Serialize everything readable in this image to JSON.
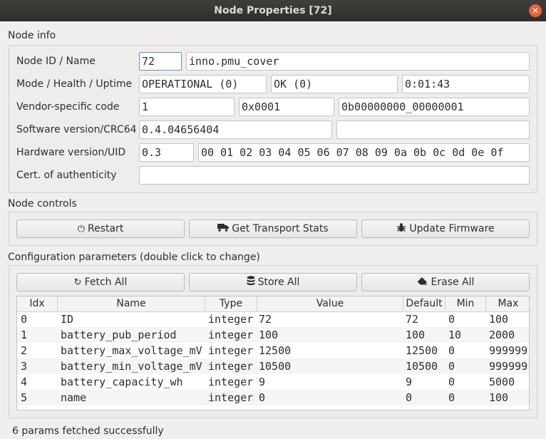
{
  "window": {
    "title": "Node Properties [72]"
  },
  "node_info": {
    "section_label": "Node info",
    "rows": {
      "id_name": {
        "label": "Node ID / Name",
        "id": "72",
        "name": "inno.pmu_cover"
      },
      "mode": {
        "label": "Mode / Health / Uptime",
        "mode": "OPERATIONAL (0)",
        "health": "OK (0)",
        "uptime": "0:01:43"
      },
      "vendor": {
        "label": "Vendor-specific code",
        "code": "1",
        "hex": "0x0001",
        "bin": "0b00000000_00000001"
      },
      "software": {
        "label": "Software version/CRC64",
        "version": "0.4.04656404",
        "crc": ""
      },
      "hardware": {
        "label": "Hardware version/UID",
        "version": "0.3",
        "uid": "00 01 02 03 04 05 06 07 08 09 0a 0b 0c 0d 0e 0f"
      },
      "cert": {
        "label": "Cert. of authenticity",
        "value": ""
      }
    }
  },
  "node_controls": {
    "section_label": "Node controls",
    "restart": "Restart",
    "transport": "Get Transport Stats",
    "firmware": "Update Firmware"
  },
  "config": {
    "section_label": "Configuration parameters (double click to change)",
    "fetch": "Fetch All",
    "store": "Store All",
    "erase": "Erase All",
    "columns": [
      "Idx",
      "Name",
      "Type",
      "Value",
      "Default",
      "Min",
      "Max"
    ],
    "rows": [
      [
        "0",
        "ID",
        "integer",
        "72",
        "72",
        "0",
        "100"
      ],
      [
        "1",
        "battery_pub_period",
        "integer",
        "100",
        "100",
        "10",
        "2000"
      ],
      [
        "2",
        "battery_max_voltage_mV",
        "integer",
        "12500",
        "12500",
        "0",
        "999999"
      ],
      [
        "3",
        "battery_min_voltage_mV",
        "integer",
        "10500",
        "10500",
        "0",
        "999999"
      ],
      [
        "4",
        "battery_capacity_wh",
        "integer",
        "9",
        "9",
        "0",
        "5000"
      ],
      [
        "5",
        "name",
        "integer",
        "0",
        "0",
        "0",
        "100"
      ]
    ]
  },
  "status": "6 params fetched successfully"
}
